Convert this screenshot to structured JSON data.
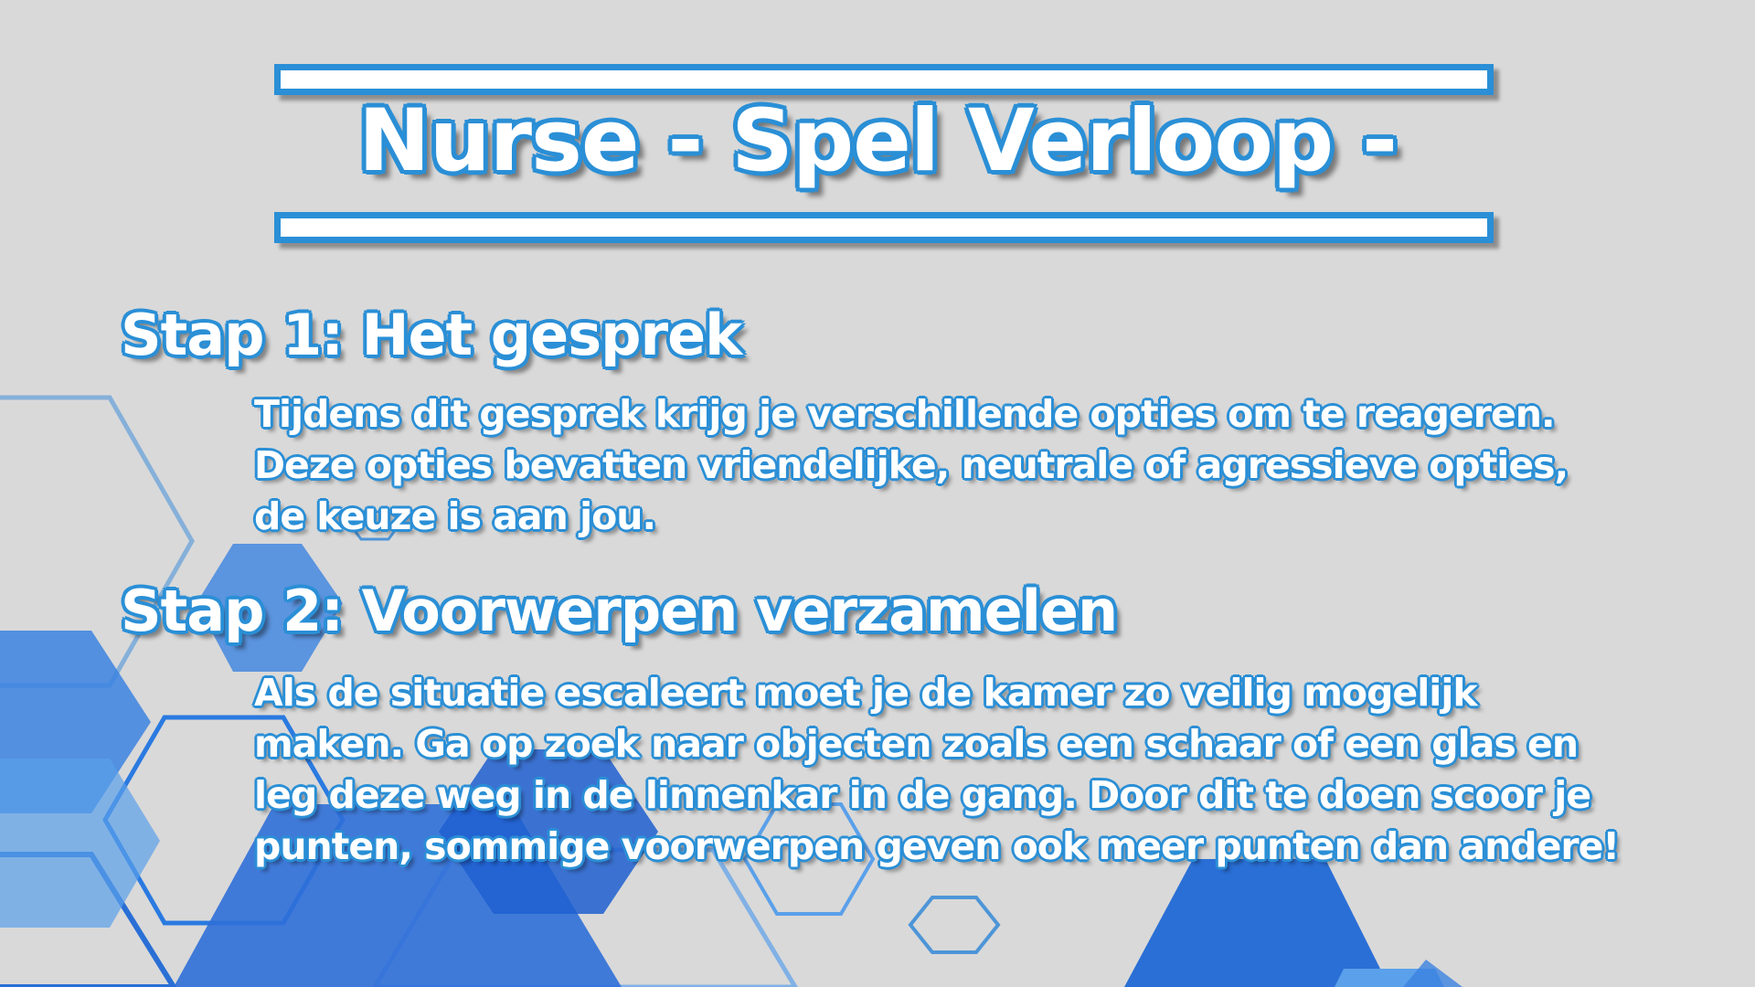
{
  "title": "Nurse - Spel Verloop -",
  "steps": [
    {
      "heading": "Stap 1: Het gesprek",
      "lines": [
        "Tijdens dit gesprek krijg je verschillende opties om te reageren.",
        "Deze opties bevatten vriendelijke, neutrale of agressieve opties,",
        "de keuze is aan jou."
      ]
    },
    {
      "heading": "Stap 2: Voorwerpen verzamelen",
      "lines": [
        "Als de situatie escaleert moet je de kamer zo veilig mogelijk",
        "maken. Ga op zoek naar objecten zoals een schaar of een glas en",
        "leg deze weg in de linnenkar in de gang. Door dit te doen scoor je",
        "punten, sommige voorwerpen geven ook meer punten dan andere!"
      ]
    }
  ],
  "colors": {
    "background": "#d9d9d9",
    "accent": "#2a8fd6",
    "text": "#ffffff",
    "hex_dark": "#1f5fd0",
    "hex_mid": "#3b82e0",
    "hex_light": "#5aa0ea"
  }
}
